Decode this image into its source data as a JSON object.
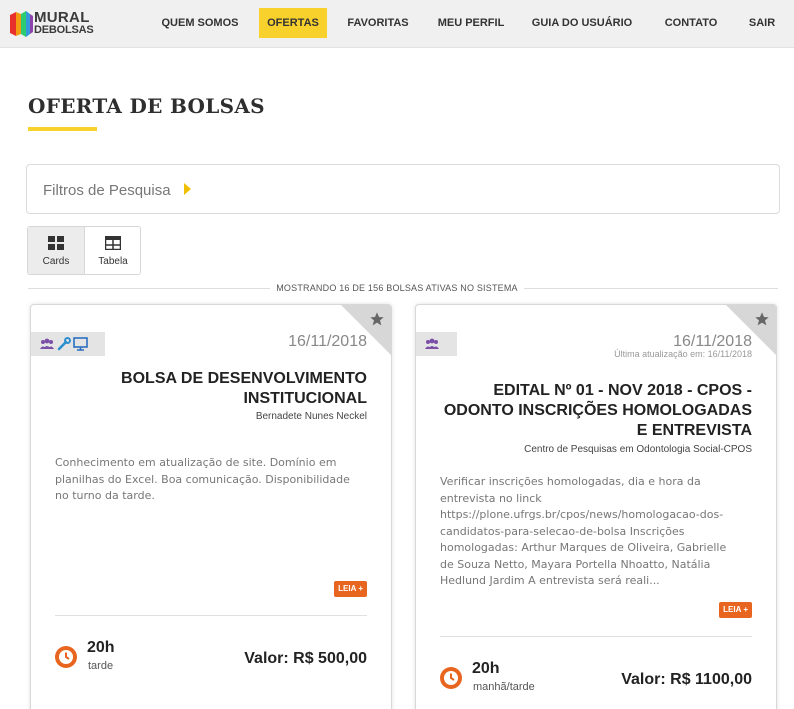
{
  "brand": {
    "name_line1": "MURAL",
    "name_line2": "DEBOLSAS",
    "colors": [
      "#e8302d",
      "#f39c12",
      "#2ecc71",
      "#3498db",
      "#8e44ad"
    ]
  },
  "nav": {
    "items": [
      {
        "label": "QUEM SOMOS",
        "active": false
      },
      {
        "label": "OFERTAS",
        "active": true
      },
      {
        "label": "FAVORITAS",
        "active": false
      },
      {
        "label": "MEU PERFIL",
        "active": false
      },
      {
        "label": "GUIA DO USUÁRIO",
        "active": false
      },
      {
        "label": "CONTATO",
        "active": false
      },
      {
        "label": "SAIR",
        "active": false
      }
    ],
    "accent": "#f9d12c"
  },
  "page": {
    "title": "OFERTA DE BOLSAS"
  },
  "filters": {
    "label": "Filtros de Pesquisa"
  },
  "view_toggle": {
    "cards_label": "Cards",
    "table_label": "Tabela",
    "active": "Cards"
  },
  "summary": {
    "text": "MOSTRANDO 16 DE 156 BOLSAS ATIVAS NO SISTEMA"
  },
  "cards": [
    {
      "date": "16/11/2018",
      "updated": "",
      "title_lines": [
        "BOLSA DE DESENVOLVIMENTO",
        "INSTITUCIONAL"
      ],
      "author": "Bernadete Nunes Neckel",
      "description_lines": [
        "Conhecimento em atualização de site. Domínio em",
        "planilhas do Excel. Boa comunicação. Disponibilidade",
        "no turno da tarde."
      ],
      "read_more": "LEIA +",
      "hours": "20h",
      "period": "tarde",
      "valor": "Valor: R$ 500,00",
      "badge_icons": [
        "users-icon",
        "wrench-icon",
        "monitor-icon"
      ]
    },
    {
      "date": "16/11/2018",
      "updated": "Última atualização em: 16/11/2018",
      "title_lines": [
        "EDITAL Nº 01 - NOV 2018 - CPOS -",
        "ODONTO INSCRIÇÕES HOMOLOGADAS",
        "E ENTREVISTA"
      ],
      "author": "Centro de Pesquisas em Odontologia Social-CPOS",
      "description_lines": [
        "Verificar inscrições homologadas, dia e hora da",
        "entrevista no linck",
        "https://plone.ufrgs.br/cpos/news/homologacao-dos-",
        "candidatos-para-selecao-de-bolsa Inscrições",
        "homologadas: Arthur Marques de Oliveira, Gabrielle",
        "de Souza Netto, Mayara Portella Nhoatto, Natália",
        "Hedlund Jardim A entrevista será reali..."
      ],
      "read_more": "LEIA +",
      "hours": "20h",
      "period": "manhã/tarde",
      "valor": "Valor: R$ 1100,00",
      "badge_icons": [
        "users-icon"
      ]
    }
  ],
  "colors": {
    "orange": "#e8651f",
    "purple": "#7b4fa8",
    "blue": "#2a8fd0"
  }
}
